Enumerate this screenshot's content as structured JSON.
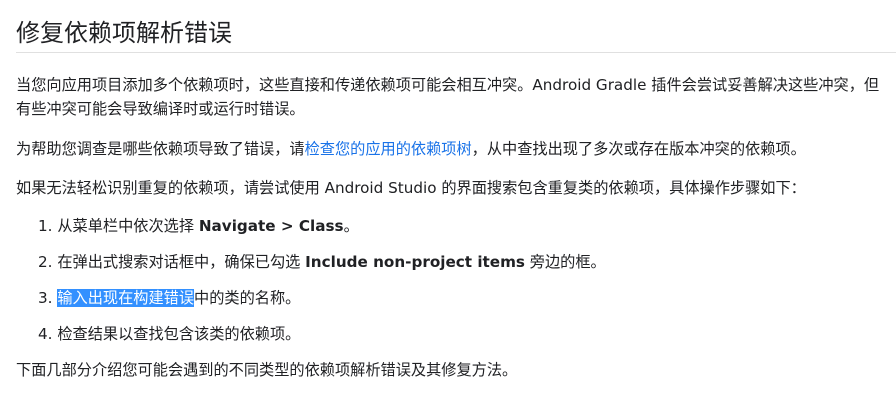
{
  "heading": "修复依赖项解析错误",
  "para1": "当您向应用项目添加多个依赖项时，这些直接和传递依赖项可能会相互冲突。Android Gradle 插件会尝试妥善解决这些冲突，但有些冲突可能会导致编译时或运行时错误。",
  "para2": {
    "before": "为帮助您调查是哪些依赖项导致了错误，请",
    "link": "检查您的应用的依赖项树",
    "after": "，从中查找出现了多次或存在版本冲突的依赖项。"
  },
  "para3": "如果无法轻松识别重复的依赖项，请尝试使用 Android Studio 的界面搜索包含重复类的依赖项，具体操作步骤如下：",
  "steps": [
    {
      "num": "1.",
      "before": "从菜单栏中依次选择 ",
      "bold": "Navigate > Class",
      "after": "。"
    },
    {
      "num": "2.",
      "before": "在弹出式搜索对话框中，确保已勾选 ",
      "bold": "Include non-project items",
      "after": " 旁边的框。"
    },
    {
      "num": "3.",
      "selected": "输入出现在构建错误",
      "after": "中的类的名称。"
    },
    {
      "num": "4.",
      "text": "检查结果以查找包含该类的依赖项。"
    }
  ],
  "para4": "下面几部分介绍您可能会遇到的不同类型的依赖项解析错误及其修复方法。",
  "colors": {
    "link": "#1a73e8",
    "selection": "#3390ff",
    "text": "#202124"
  }
}
